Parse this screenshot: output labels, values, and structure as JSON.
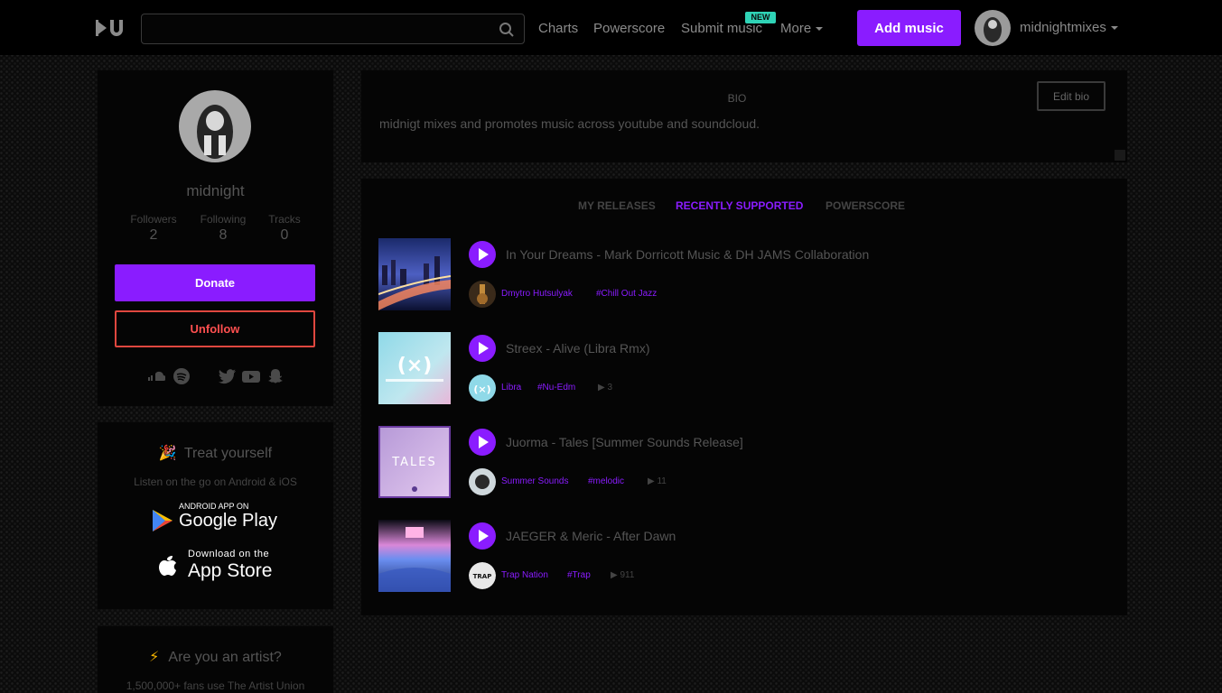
{
  "nav": {
    "search_placeholder": "",
    "links": [
      "Charts",
      "Powerscore",
      "Submit music",
      "More"
    ],
    "new_badge": "NEW",
    "add_music": "Add music",
    "username": "midnightmixes"
  },
  "profile": {
    "name": "midnight",
    "stats": [
      {
        "label": "Followers",
        "value": "2"
      },
      {
        "label": "Following",
        "value": "8"
      },
      {
        "label": "Tracks",
        "value": "0"
      }
    ],
    "donate": "Donate",
    "unfollow": "Unfollow",
    "socials": [
      "soundcloud-icon",
      "spotify-icon",
      "twitter-icon",
      "youtube-icon",
      "snapchat-icon"
    ]
  },
  "promo": {
    "emoji": "🎉",
    "title": "Treat yourself",
    "subtitle": "Listen on the go on Android & iOS",
    "google_small": "ANDROID APP ON",
    "google_big": "Google Play",
    "apple_small": "Download on the",
    "apple_big": "App Store"
  },
  "artist": {
    "icon": "⚡",
    "title": "Are you an artist?",
    "subtitle": "1,500,000+ fans use The Artist Union"
  },
  "bio": {
    "label": "BIO",
    "edit": "Edit bio",
    "text": "midnigt mixes and promotes music across youtube and soundcloud."
  },
  "tabs": [
    "MY RELEASES",
    "RECENTLY SUPPORTED",
    "POWERSCORE"
  ],
  "active_tab": "RECENTLY SUPPORTED",
  "tracks": [
    {
      "title": "In Your Dreams - Mark Dorricott Music & DH JAMS Collaboration",
      "owner": "Dmytro Hutsulyak",
      "tag": "#Chill Out Jazz",
      "plays": ""
    },
    {
      "title": "Streex - Alive (Libra Rmx)",
      "owner": "Libra",
      "tag": "#Nu-Edm",
      "plays": "3"
    },
    {
      "title": "Juorma - Tales [Summer Sounds Release]",
      "owner": "Summer Sounds",
      "tag": "#melodic",
      "plays": "11"
    },
    {
      "title": "JAEGER & Meric - After Dawn",
      "owner": "Trap Nation",
      "tag": "#Trap",
      "plays": "911"
    }
  ],
  "colors": {
    "accent": "#8a1cff",
    "danger": "#e0473f",
    "badge": "#2fd3b6"
  }
}
